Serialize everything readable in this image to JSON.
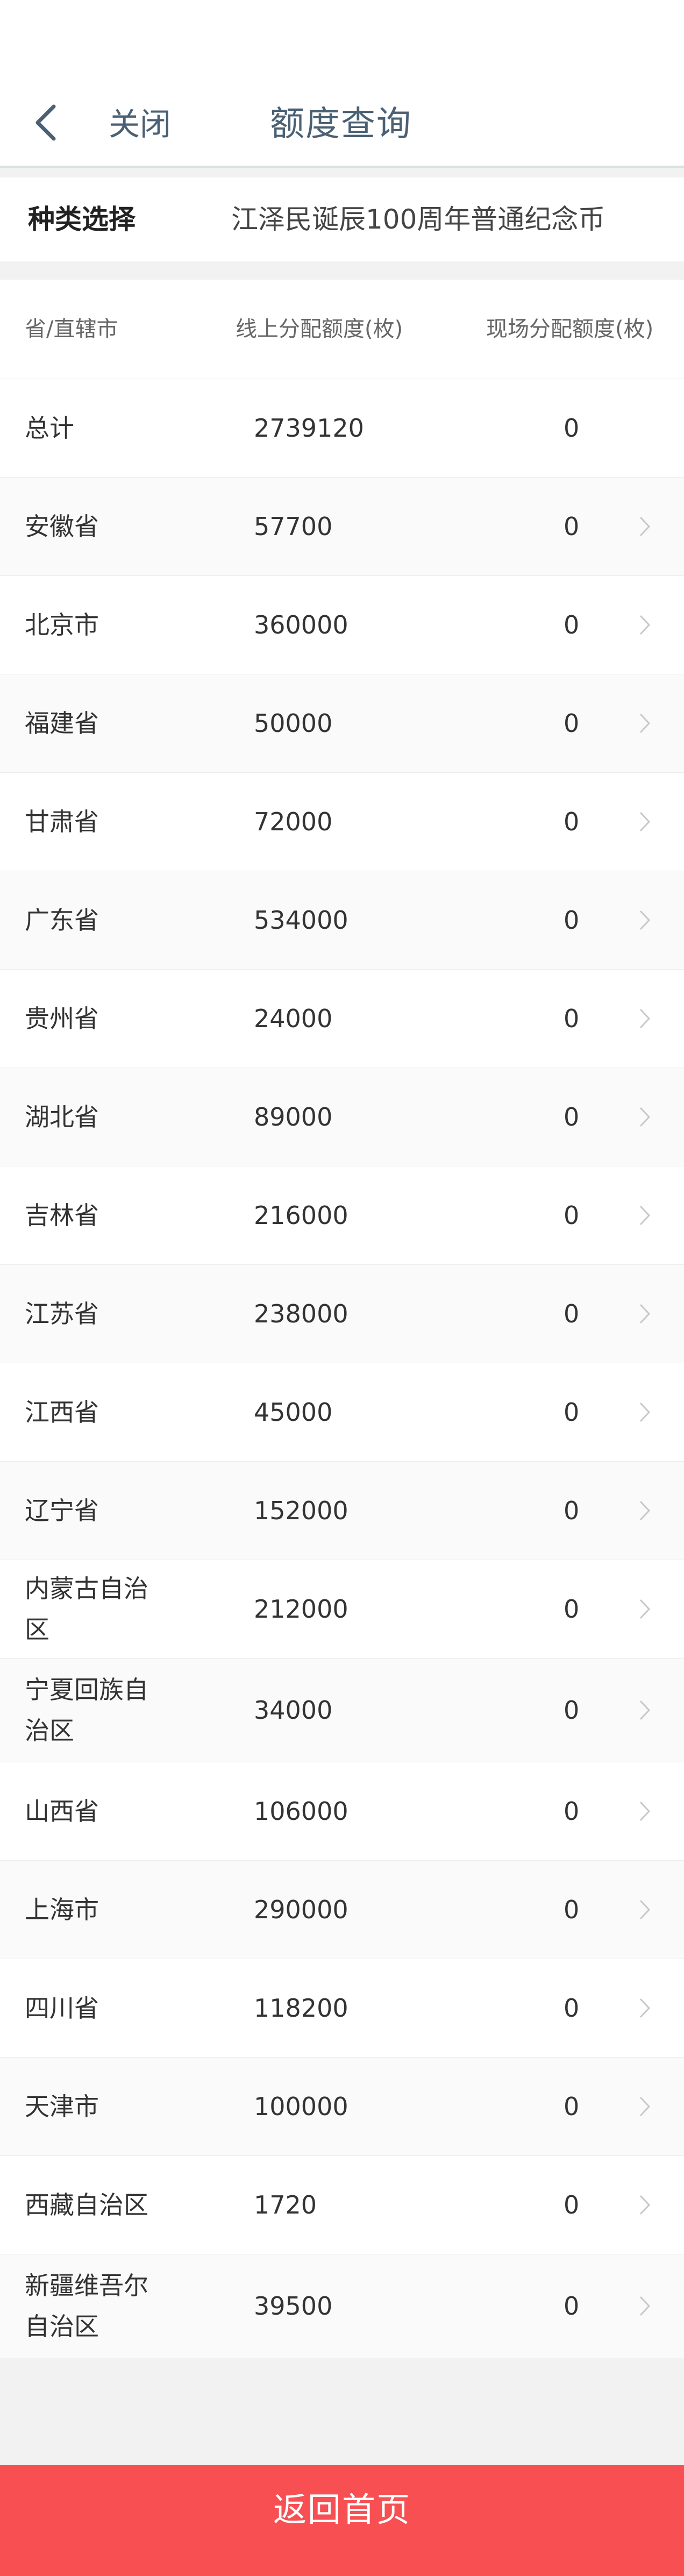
{
  "header": {
    "close_label": "关闭",
    "title": "额度查询",
    "back_icon": "chevron-left-icon",
    "accent_color": "#4a6074"
  },
  "type_selector": {
    "label": "种类选择",
    "value": "江泽民诞辰100周年普通纪念币"
  },
  "table": {
    "columns": [
      "省/直辖市",
      "线上分配额度(枚)",
      "现场分配额度(枚)"
    ],
    "rows": [
      {
        "name": "总计",
        "online": "2739120",
        "onsite": "0"
      },
      {
        "name": "安徽省",
        "online": "57700",
        "onsite": "0"
      },
      {
        "name": "北京市",
        "online": "360000",
        "onsite": "0"
      },
      {
        "name": "福建省",
        "online": "50000",
        "onsite": "0"
      },
      {
        "name": "甘肃省",
        "online": "72000",
        "onsite": "0"
      },
      {
        "name": "广东省",
        "online": "534000",
        "onsite": "0"
      },
      {
        "name": "贵州省",
        "online": "24000",
        "onsite": "0"
      },
      {
        "name": "湖北省",
        "online": "89000",
        "onsite": "0"
      },
      {
        "name": "吉林省",
        "online": "216000",
        "onsite": "0"
      },
      {
        "name": "江苏省",
        "online": "238000",
        "onsite": "0"
      },
      {
        "name": "江西省",
        "online": "45000",
        "onsite": "0"
      },
      {
        "name": "辽宁省",
        "online": "152000",
        "onsite": "0"
      },
      {
        "name": "内蒙古自治区",
        "online": "212000",
        "onsite": "0"
      },
      {
        "name": "宁夏回族自治区",
        "online": "34000",
        "onsite": "0"
      },
      {
        "name": "山西省",
        "online": "106000",
        "onsite": "0"
      },
      {
        "name": "上海市",
        "online": "290000",
        "onsite": "0"
      },
      {
        "name": "四川省",
        "online": "118200",
        "onsite": "0"
      },
      {
        "name": "天津市",
        "online": "100000",
        "onsite": "0"
      },
      {
        "name": "西藏自治区",
        "online": "1720",
        "onsite": "0"
      },
      {
        "name": "新疆维吾尔自治区",
        "online": "39500",
        "onsite": "0"
      }
    ]
  },
  "footer": {
    "home_button_label": "返回首页",
    "button_color": "#f74f52"
  }
}
